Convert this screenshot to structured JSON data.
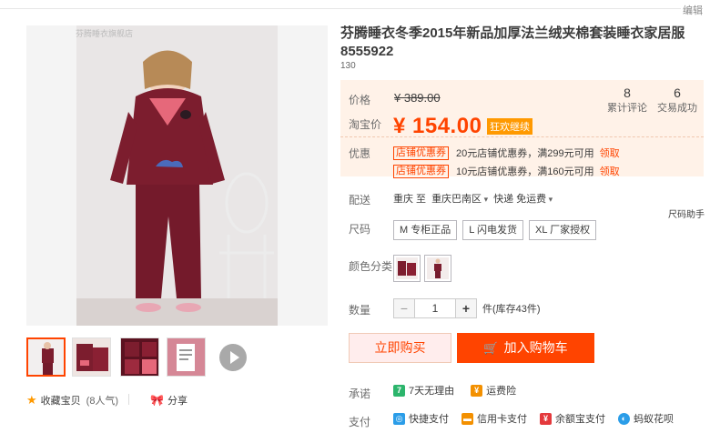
{
  "topbar": {
    "edit_label": "编辑"
  },
  "gallery": {
    "watermark": "芬腾睡衣旗舰店",
    "thumbnails": [
      "主图",
      "平铺图",
      "细节图",
      "吊牌图"
    ]
  },
  "actions": {
    "favorite_label": "收藏宝贝",
    "favorite_count": "(8人气)",
    "share_label": "分享"
  },
  "product": {
    "title": "芬腾睡衣冬季2015年新品加厚法兰绒夹棉套装睡衣家居服8555922",
    "code": "130"
  },
  "price": {
    "price_label": "价格",
    "original": "¥ 389.00",
    "taobao_label": "淘宝价",
    "current": "¥ 154.00",
    "promo_badge": "狂欢继续"
  },
  "stats": [
    {
      "num": "8",
      "label": "累计评论"
    },
    {
      "num": "6",
      "label": "交易成功"
    }
  ],
  "coupons": {
    "label": "优惠",
    "items": [
      {
        "tag": "店铺优惠券",
        "text": "20元店铺优惠券，满299元可用",
        "action": "领取"
      },
      {
        "tag": "店铺优惠券",
        "text": "10元店铺优惠券，满160元可用",
        "action": "领取"
      }
    ]
  },
  "shipping": {
    "label": "配送",
    "from": "重庆 至",
    "to": "重庆巴南区",
    "method": "快递 免运费"
  },
  "helper": "尺码助手",
  "size": {
    "label": "尺码",
    "options": [
      "M 专柜正品",
      "L 闪电发货",
      "XL 厂家授权"
    ]
  },
  "color": {
    "label": "颜色分类",
    "options": [
      "酒红",
      "粉色"
    ]
  },
  "quantity": {
    "label": "数量",
    "value": "1",
    "stock": "件(库存43件)"
  },
  "buttons": {
    "buy": "立即购买",
    "cart": "加入购物车"
  },
  "promise": {
    "label": "承诺",
    "items": [
      {
        "icon": "seven-day-icon",
        "glyph": "7",
        "text": "7天无理由",
        "color": "#2cb56c"
      },
      {
        "icon": "insurance-icon",
        "glyph": "¥",
        "text": "运费险",
        "color": "#f39000"
      }
    ]
  },
  "payment": {
    "label": "支付",
    "items": [
      {
        "icon": "quickpay-icon",
        "glyph": "◎",
        "text": "快捷支付",
        "color": "#2b9de8"
      },
      {
        "icon": "credit-card-icon",
        "glyph": "▬",
        "text": "信用卡支付",
        "color": "#f39000"
      },
      {
        "icon": "yuebao-icon",
        "glyph": "¥",
        "text": "余额宝支付",
        "color": "#e4393c"
      },
      {
        "icon": "huabei-icon",
        "glyph": "◐",
        "text": "蚂蚁花呗",
        "color": "#2b9de8"
      }
    ]
  },
  "colors": {
    "accent": "#ff4400",
    "price_panel": "#fff2e8",
    "badge": "#ff9900"
  }
}
